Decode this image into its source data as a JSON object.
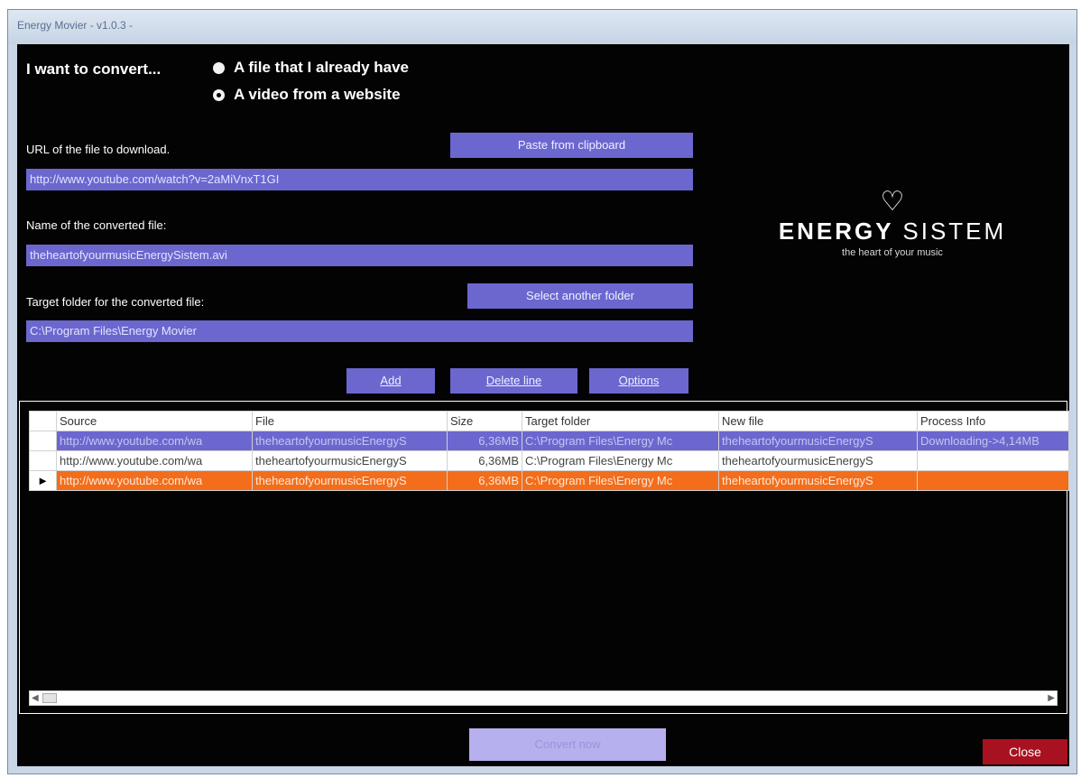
{
  "window": {
    "title": "Energy Movier - v1.0.3 -"
  },
  "convert": {
    "label": "I want to convert...",
    "option_file": "A file that I already have",
    "option_video": "A video from a website"
  },
  "url": {
    "label": "URL of the file to download.",
    "value": "http://www.youtube.com/watch?v=2aMiVnxT1GI"
  },
  "paste_button": "Paste from clipboard",
  "name": {
    "label": "Name of the converted file:",
    "value": "theheartofyourmusicEnergySistem.avi"
  },
  "target": {
    "label": "Target folder for the converted file:",
    "value": "C:\\Program Files\\Energy Movier"
  },
  "select_folder_button": "Select another folder",
  "actions": {
    "add": "Add",
    "delete": "Delete line",
    "options": "Options"
  },
  "logo": {
    "brand_bold": "ENERGY",
    "brand_light": "SISTEM",
    "tagline": "the heart of your music"
  },
  "table": {
    "columns": [
      "Source",
      "File",
      "Size",
      "Target folder",
      "New file",
      "Process Info"
    ],
    "rows": [
      {
        "source": "http://www.youtube.com/wa",
        "file": "theheartofyourmusicEnergyS",
        "size": "6,36MB",
        "target": "C:\\Program Files\\Energy Mc",
        "new_file": "theheartofyourmusicEnergyS",
        "info": "Downloading->4,14MB",
        "selected": false
      },
      {
        "source": "http://www.youtube.com/wa",
        "file": "theheartofyourmusicEnergyS",
        "size": "6,36MB",
        "target": "C:\\Program Files\\Energy Mc",
        "new_file": "theheartofyourmusicEnergyS",
        "info": "",
        "selected": false
      },
      {
        "source": "http://www.youtube.com/wa",
        "file": "theheartofyourmusicEnergyS",
        "size": "6,36MB",
        "target": "C:\\Program Files\\Energy Mc",
        "new_file": "theheartofyourmusicEnergyS",
        "info": "",
        "selected": true
      }
    ],
    "row_marker": "►"
  },
  "convert_now": "Convert now",
  "close": "Close",
  "colors": {
    "accent": "#6b67cf",
    "highlight": "#f36d1b",
    "close": "#a8111f",
    "background": "#030303"
  }
}
